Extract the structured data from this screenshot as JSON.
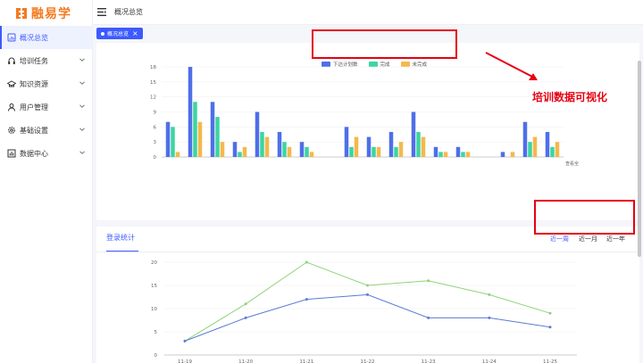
{
  "app": {
    "logo_text": "融易学"
  },
  "header": {
    "title": "概况总览"
  },
  "sidebar": {
    "items": [
      {
        "label": "概况总览",
        "icon": "dashboard-icon",
        "active": true
      },
      {
        "label": "培训任务",
        "icon": "headset-icon",
        "active": false
      },
      {
        "label": "知识资源",
        "icon": "graduation-icon",
        "active": false
      },
      {
        "label": "用户管理",
        "icon": "user-icon",
        "active": false
      },
      {
        "label": "基础设置",
        "icon": "gear-icon",
        "active": false
      },
      {
        "label": "数据中心",
        "icon": "bar-chart-icon",
        "active": false
      }
    ]
  },
  "tag": {
    "label": "概况总览"
  },
  "annotation": {
    "text": "培训数据可视化"
  },
  "stats": {
    "tab_label": "登录统计",
    "ranges": [
      "近一周",
      "近一月",
      "近一年"
    ]
  },
  "colors": {
    "primary": "#3d5afe",
    "blue": "#4e6fe8",
    "green": "#3dd5a0",
    "yellow": "#f5b84d",
    "red": "#e60012"
  },
  "chart_data": [
    {
      "type": "bar",
      "title": "",
      "series": [
        {
          "name": "下达计划数",
          "values": [
            7,
            18,
            11,
            3,
            9,
            5,
            3,
            0,
            6,
            4,
            5,
            9,
            2,
            2,
            0,
            1,
            7,
            5
          ]
        },
        {
          "name": "完成",
          "values": [
            6,
            11,
            8,
            1,
            5,
            3,
            2,
            0,
            2,
            2,
            2,
            5,
            1,
            1,
            0,
            0,
            3,
            2
          ]
        },
        {
          "name": "未完成",
          "values": [
            1,
            7,
            3,
            2,
            4,
            2,
            1,
            0,
            4,
            2,
            3,
            4,
            1,
            1,
            0,
            1,
            4,
            3
          ]
        }
      ],
      "ylim": [
        0,
        18
      ],
      "yticks": [
        0,
        3,
        6,
        9,
        12,
        15,
        18
      ],
      "corner_label": "查看全"
    },
    {
      "type": "line",
      "title": "",
      "x": [
        "11-19",
        "11-20",
        "11-21",
        "11-22",
        "11-23",
        "11-24",
        "11-25"
      ],
      "series": [
        {
          "values": [
            3,
            11,
            20,
            15,
            16,
            13,
            9
          ],
          "color": "#8fd27a"
        },
        {
          "values": [
            3,
            8,
            12,
            13,
            8,
            8,
            6
          ],
          "color": "#5b7bd5"
        }
      ],
      "ylim": [
        0,
        20
      ],
      "yticks": [
        0,
        5,
        10,
        15,
        20
      ]
    }
  ]
}
